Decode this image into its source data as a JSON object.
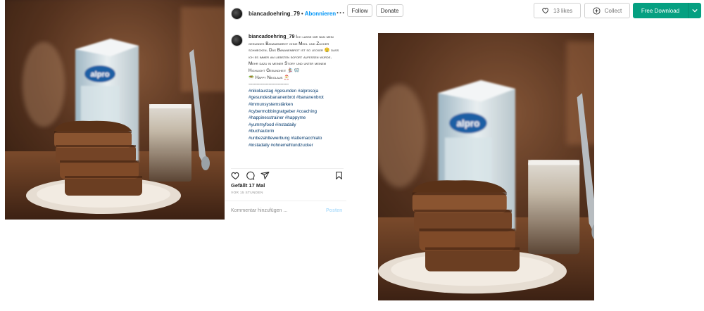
{
  "post": {
    "username": "biancadoehring_79",
    "separator": "•",
    "follow_label": "Abonnieren",
    "more_label": "...",
    "caption_username": "biancadoehring_79",
    "caption_line1": "Ich lasse mir nun mein gesundes Bananenbrot ohne Mehl und Zucker schmecken. Das Bananenbrot ist so lecker 🤤 dass ich es immer am liebsten sofort aufessen würde.",
    "caption_line2": "Mehr dazu in meiner Story und unter meinem Highlight Gesundheit 🏂 🥽",
    "caption_line3": "🥗 Happy Nikolaus 🎅",
    "caption_separator": "------------------------------",
    "hashtags": [
      "#nikolaustag #gesunden #alprosoja",
      "#gesundesbananenbrot #bananenbrot",
      "#immunsystemstärken",
      "#cybermobbingratgeber #coaching",
      "#happinesstrainer #happyme",
      "#yummyfood #instadaily",
      "#buchautorin",
      "#unbezahltewerbung #lattemacchiato",
      "#instadaily #ohnemehlundzucker"
    ],
    "likes": "Gefällt 17 Mal",
    "time_ago": "VOR 15 STUNDEN",
    "comment_placeholder": "Kommentar hinzufügen ...",
    "post_button": "Posten"
  },
  "toolbar": {
    "follow_label": "Follow",
    "donate_label": "Donate",
    "likes_label": "13 likes",
    "collect_label": "Collect",
    "download_label": "Free Download"
  },
  "photo": {
    "carton_brand": "alpro"
  },
  "colors": {
    "download_green": "#05a081",
    "instagram_link": "#0095f6",
    "hashtag": "#00376b"
  },
  "icons": [
    "heart-icon",
    "comment-icon",
    "share-icon",
    "bookmark-icon",
    "plus-circle-icon",
    "chevron-down-icon"
  ]
}
